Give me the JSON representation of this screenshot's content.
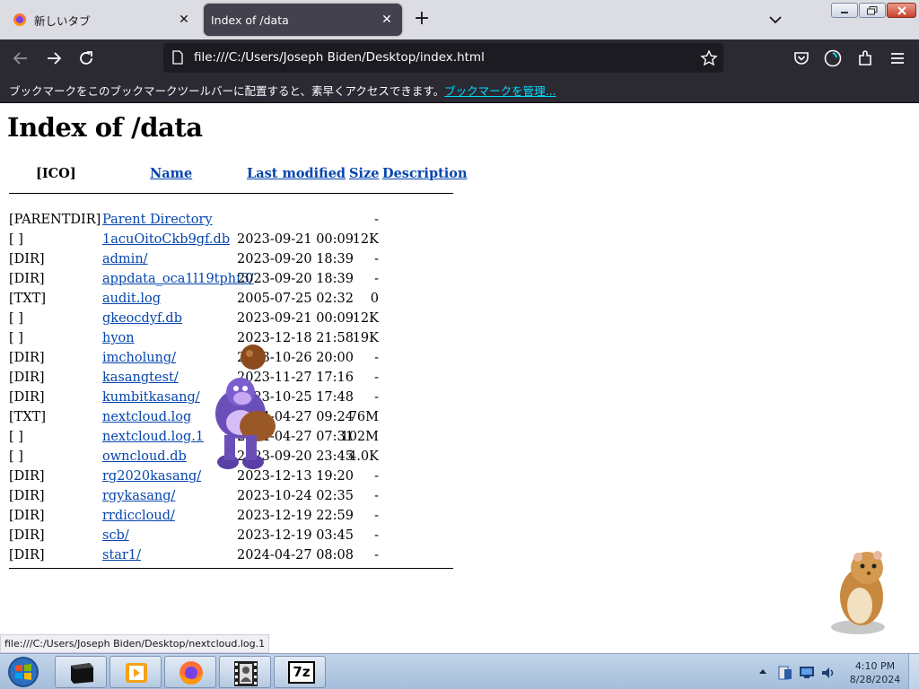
{
  "browser": {
    "tabs": [
      {
        "title": "新しいタブ"
      },
      {
        "title": "Index of /data"
      }
    ],
    "new_tab_label": "+",
    "url": "file:///C:/Users/Joseph Biden/Desktop/index.html",
    "bookmarks_bar": {
      "message": "ブックマークをこのブックマークツールバーに配置すると、素早くアクセスできます。",
      "manage_link": "ブックマークを管理..."
    },
    "status_url": "file:///C:/Users/Joseph Biden/Desktop/nextcloud.log.1"
  },
  "page": {
    "title": "Index of /data",
    "headers": {
      "icon": "[ICO]",
      "name": "Name",
      "modified": "Last modified",
      "size": "Size",
      "description": "Description"
    },
    "rows": [
      {
        "icon": "[PARENTDIR]",
        "name": "Parent Directory",
        "date": "",
        "size": "-"
      },
      {
        "icon": "[ ]",
        "name": "1acuOitoCkb9gf.db",
        "date": "2023-09-21 00:09",
        "size": "12K"
      },
      {
        "icon": "[DIR]",
        "name": "admin/",
        "date": "2023-09-20 18:39",
        "size": "-"
      },
      {
        "icon": "[DIR]",
        "name": "appdata_oca1l19tphf3/",
        "date": "2023-09-20 18:39",
        "size": "-"
      },
      {
        "icon": "[TXT]",
        "name": "audit.log",
        "date": "2005-07-25 02:32",
        "size": "0"
      },
      {
        "icon": "[ ]",
        "name": "gkeocdyf.db",
        "date": "2023-09-21 00:09",
        "size": "12K"
      },
      {
        "icon": "[ ]",
        "name": "hyon",
        "date": "2023-12-18 21:58",
        "size": "19K"
      },
      {
        "icon": "[DIR]",
        "name": "imcholung/",
        "date": "2023-10-26 20:00",
        "size": "-"
      },
      {
        "icon": "[DIR]",
        "name": "kasangtest/",
        "date": "2023-11-27 17:16",
        "size": "-"
      },
      {
        "icon": "[DIR]",
        "name": "kumbitkasang/",
        "date": "2023-10-25 17:48",
        "size": "-"
      },
      {
        "icon": "[TXT]",
        "name": "nextcloud.log",
        "date": "2024-04-27 09:24",
        "size": "76M"
      },
      {
        "icon": "[ ]",
        "name": "nextcloud.log.1",
        "date": "2024-04-27 07:31",
        "size": "102M"
      },
      {
        "icon": "[ ]",
        "name": "owncloud.db",
        "date": "2023-09-20 23:45",
        "size": "4.0K"
      },
      {
        "icon": "[DIR]",
        "name": "rg2020kasang/",
        "date": "2023-12-13 19:20",
        "size": "-"
      },
      {
        "icon": "[DIR]",
        "name": "rgykasang/",
        "date": "2023-10-24 02:35",
        "size": "-"
      },
      {
        "icon": "[DIR]",
        "name": "rrdiccloud/",
        "date": "2023-12-19 22:59",
        "size": "-"
      },
      {
        "icon": "[DIR]",
        "name": "scb/",
        "date": "2023-12-19 03:45",
        "size": "-"
      },
      {
        "icon": "[DIR]",
        "name": "star1/",
        "date": "2024-04-27 08:08",
        "size": "-"
      }
    ]
  },
  "taskbar": {
    "apps": [
      "terminal-app",
      "media-player-app",
      "firefox-app",
      "filmstrip-app",
      "7zip-app"
    ],
    "zip_label": "7z",
    "time": "4:10 PM",
    "date": "8/28/2024"
  },
  "colors": {
    "link": "#0645ad",
    "chrome_dark": "#2b2a33",
    "bookmark_link": "#00ddff"
  }
}
